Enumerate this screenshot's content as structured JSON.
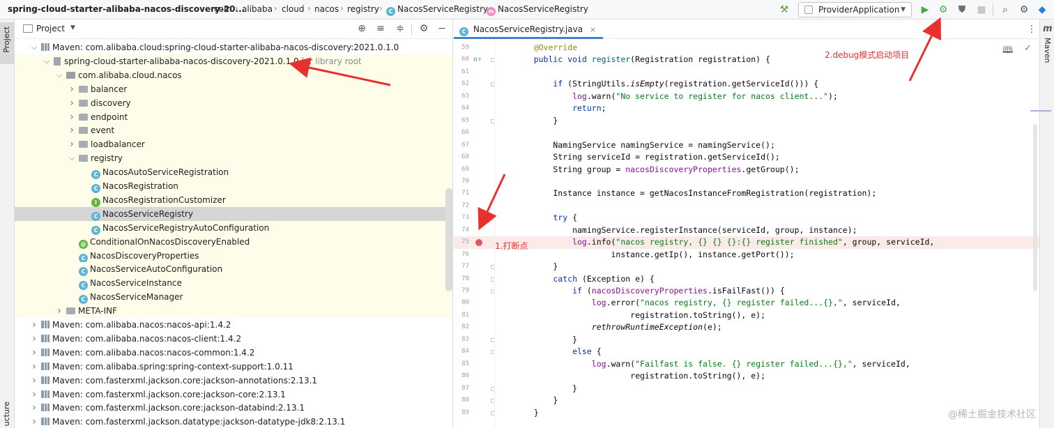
{
  "navbar": {
    "crumbs": [
      "spring-cloud-starter-alibaba-nacos-discovery-20...",
      "com",
      "alibaba",
      "cloud",
      "nacos",
      "registry",
      "NacosServiceRegistry",
      "NacosServiceRegistry"
    ],
    "run_config": "ProviderApplication"
  },
  "side": {
    "left_tab_top": "Project",
    "left_tab_bottom": "ucture",
    "right_tab_top": "m",
    "right_tab_label": "Maven"
  },
  "project_panel": {
    "title": "Project",
    "tree": [
      {
        "label": "Maven: com.alibaba.cloud:spring-cloud-starter-alibaba-nacos-discovery:2021.0.1.0",
        "icon": "maven-lib-icon",
        "depth": 2,
        "arrow": "down",
        "lib": false
      },
      {
        "label": "spring-cloud-starter-alibaba-nacos-discovery-2021.0.1.0.jar",
        "suffix": "library root",
        "icon": "jar-icon",
        "depth": 3,
        "arrow": "down",
        "lib": true
      },
      {
        "label": "com.alibaba.cloud.nacos",
        "icon": "package-icon",
        "depth": 4,
        "arrow": "down",
        "lib": true
      },
      {
        "label": "balancer",
        "icon": "folder-icon",
        "depth": 5,
        "arrow": "right",
        "lib": true
      },
      {
        "label": "discovery",
        "icon": "folder-icon",
        "depth": 5,
        "arrow": "right",
        "lib": true
      },
      {
        "label": "endpoint",
        "icon": "folder-icon",
        "depth": 5,
        "arrow": "right",
        "lib": true
      },
      {
        "label": "event",
        "icon": "folder-icon",
        "depth": 5,
        "arrow": "right",
        "lib": true
      },
      {
        "label": "loadbalancer",
        "icon": "folder-icon",
        "depth": 5,
        "arrow": "right",
        "lib": true
      },
      {
        "label": "registry",
        "icon": "folder-icon",
        "depth": 5,
        "arrow": "down",
        "lib": true
      },
      {
        "label": "NacosAutoServiceRegistration",
        "icon": "class-icon",
        "depth": 6,
        "arrow": "",
        "lib": true
      },
      {
        "label": "NacosRegistration",
        "icon": "class-icon",
        "depth": 6,
        "arrow": "",
        "lib": true
      },
      {
        "label": "NacosRegistrationCustomizer",
        "icon": "interface-icon",
        "depth": 6,
        "arrow": "",
        "lib": true
      },
      {
        "label": "NacosServiceRegistry",
        "icon": "class-icon",
        "depth": 6,
        "arrow": "",
        "lib": true,
        "selected": true
      },
      {
        "label": "NacosServiceRegistryAutoConfiguration",
        "icon": "class-icon",
        "depth": 6,
        "arrow": "",
        "lib": true
      },
      {
        "label": "ConditionalOnNacosDiscoveryEnabled",
        "icon": "annotation-icon",
        "depth": 5,
        "arrow": "",
        "lib": true
      },
      {
        "label": "NacosDiscoveryProperties",
        "icon": "class-icon",
        "depth": 5,
        "arrow": "",
        "lib": true
      },
      {
        "label": "NacosServiceAutoConfiguration",
        "icon": "class-icon",
        "depth": 5,
        "arrow": "",
        "lib": true
      },
      {
        "label": "NacosServiceInstance",
        "icon": "class-icon",
        "depth": 5,
        "arrow": "",
        "lib": true
      },
      {
        "label": "NacosServiceManager",
        "icon": "class-icon",
        "depth": 5,
        "arrow": "",
        "lib": true
      },
      {
        "label": "META-INF",
        "icon": "folder-icon",
        "depth": 4,
        "arrow": "right",
        "lib": true
      },
      {
        "label": "Maven: com.alibaba.nacos:nacos-api:1.4.2",
        "icon": "maven-lib-icon",
        "depth": 2,
        "arrow": "right",
        "lib": false
      },
      {
        "label": "Maven: com.alibaba.nacos:nacos-client:1.4.2",
        "icon": "maven-lib-icon",
        "depth": 2,
        "arrow": "right",
        "lib": false
      },
      {
        "label": "Maven: com.alibaba.nacos:nacos-common:1.4.2",
        "icon": "maven-lib-icon",
        "depth": 2,
        "arrow": "right",
        "lib": false
      },
      {
        "label": "Maven: com.alibaba.spring:spring-context-support:1.0.11",
        "icon": "maven-lib-icon",
        "depth": 2,
        "arrow": "right",
        "lib": false
      },
      {
        "label": "Maven: com.fasterxml.jackson.core:jackson-annotations:2.13.1",
        "icon": "maven-lib-icon",
        "depth": 2,
        "arrow": "right",
        "lib": false
      },
      {
        "label": "Maven: com.fasterxml.jackson.core:jackson-core:2.13.1",
        "icon": "maven-lib-icon",
        "depth": 2,
        "arrow": "right",
        "lib": false
      },
      {
        "label": "Maven: com.fasterxml.jackson.core:jackson-databind:2.13.1",
        "icon": "maven-lib-icon",
        "depth": 2,
        "arrow": "right",
        "lib": false
      },
      {
        "label": "Maven: com.fasterxml.jackson.datatype:jackson-datatype-jdk8:2.13.1",
        "icon": "maven-lib-icon",
        "depth": 2,
        "arrow": "right",
        "lib": false
      }
    ]
  },
  "editor": {
    "tab_label": "NacosServiceRegistry.java",
    "breakpoint_line": 75,
    "lines": [
      {
        "n": 59,
        "tokens": [
          [
            "an",
            "    @Override"
          ]
        ]
      },
      {
        "n": 60,
        "tokens": [
          [
            "kw",
            "    public void "
          ],
          [
            "fn",
            "register"
          ],
          [
            "",
            "(Registration registration) {"
          ]
        ]
      },
      {
        "n": 61,
        "tokens": []
      },
      {
        "n": 62,
        "tokens": [
          [
            "kw",
            "        if "
          ],
          [
            "",
            "(StringUtils."
          ],
          [
            "it",
            "isEmpty"
          ],
          [
            "",
            "(registration.getServiceId())) {"
          ]
        ]
      },
      {
        "n": 63,
        "tokens": [
          [
            "fd",
            "            log"
          ],
          [
            "",
            ".warn("
          ],
          [
            "st",
            "\"No service to register for nacos client...\""
          ],
          [
            "",
            ");"
          ]
        ]
      },
      {
        "n": 64,
        "tokens": [
          [
            "kw",
            "            return"
          ],
          [
            "",
            ";"
          ]
        ]
      },
      {
        "n": 65,
        "tokens": [
          [
            "",
            "        }"
          ]
        ]
      },
      {
        "n": 66,
        "tokens": []
      },
      {
        "n": 67,
        "tokens": [
          [
            "",
            "        NamingService namingService = namingService();"
          ]
        ]
      },
      {
        "n": 68,
        "tokens": [
          [
            "",
            "        String serviceId = registration.getServiceId();"
          ]
        ]
      },
      {
        "n": 69,
        "tokens": [
          [
            "",
            "        String group = "
          ],
          [
            "fd",
            "nacosDiscoveryProperties"
          ],
          [
            "",
            ".getGroup();"
          ]
        ]
      },
      {
        "n": 70,
        "tokens": []
      },
      {
        "n": 71,
        "tokens": [
          [
            "",
            "        Instance instance = getNacosInstanceFromRegistration(registration);"
          ]
        ]
      },
      {
        "n": 72,
        "tokens": []
      },
      {
        "n": 73,
        "tokens": [
          [
            "kw",
            "        try "
          ],
          [
            "",
            "{"
          ]
        ]
      },
      {
        "n": 74,
        "tokens": [
          [
            "",
            "            namingService.registerInstance(serviceId, group, instance);"
          ]
        ]
      },
      {
        "n": 75,
        "tokens": [
          [
            "fd",
            "            log"
          ],
          [
            "",
            ".info("
          ],
          [
            "st",
            "\"nacos registry, {} {} {}:{} register finished\""
          ],
          [
            "",
            ", group, serviceId,"
          ]
        ]
      },
      {
        "n": 76,
        "tokens": [
          [
            "",
            "                    instance.getIp(), instance.getPort());"
          ]
        ]
      },
      {
        "n": 77,
        "tokens": [
          [
            "",
            "        }"
          ]
        ]
      },
      {
        "n": 78,
        "tokens": [
          [
            "kw",
            "        catch "
          ],
          [
            "",
            "(Exception e) {"
          ]
        ]
      },
      {
        "n": 79,
        "tokens": [
          [
            "kw",
            "            if "
          ],
          [
            "",
            "("
          ],
          [
            "fd",
            "nacosDiscoveryProperties"
          ],
          [
            "",
            ".isFailFast()) {"
          ]
        ]
      },
      {
        "n": 80,
        "tokens": [
          [
            "fd",
            "                log"
          ],
          [
            "",
            ".error("
          ],
          [
            "st",
            "\"nacos registry, {} register failed...{},\""
          ],
          [
            "",
            ", serviceId,"
          ]
        ]
      },
      {
        "n": 81,
        "tokens": [
          [
            "",
            "                        registration.toString(), e);"
          ]
        ]
      },
      {
        "n": 82,
        "tokens": [
          [
            "it",
            "                rethrowRuntimeException"
          ],
          [
            "",
            "(e);"
          ]
        ]
      },
      {
        "n": 83,
        "tokens": [
          [
            "",
            "            }"
          ]
        ]
      },
      {
        "n": 84,
        "tokens": [
          [
            "kw",
            "            else "
          ],
          [
            "",
            "{"
          ]
        ]
      },
      {
        "n": 85,
        "tokens": [
          [
            "fd",
            "                log"
          ],
          [
            "",
            ".warn("
          ],
          [
            "st",
            "\"Failfast is false. {} register failed...{},\""
          ],
          [
            "",
            ", serviceId,"
          ]
        ]
      },
      {
        "n": 86,
        "tokens": [
          [
            "",
            "                        registration.toString(), e);"
          ]
        ]
      },
      {
        "n": 87,
        "tokens": [
          [
            "",
            "            }"
          ]
        ]
      },
      {
        "n": 88,
        "tokens": [
          [
            "",
            "        }"
          ]
        ]
      },
      {
        "n": 89,
        "tokens": [
          [
            "",
            "    }"
          ]
        ]
      }
    ]
  },
  "annotations": {
    "step1": "1.打断点",
    "step2": "2.debug模式启动项目",
    "watermark": "@稀土掘金技术社区"
  },
  "colors": {
    "accent": "#4083c9",
    "arrow": "#e8312e",
    "breakpoint": "#db5860",
    "library_bg": "#fdfde9",
    "selection": "#d5d5d5"
  }
}
